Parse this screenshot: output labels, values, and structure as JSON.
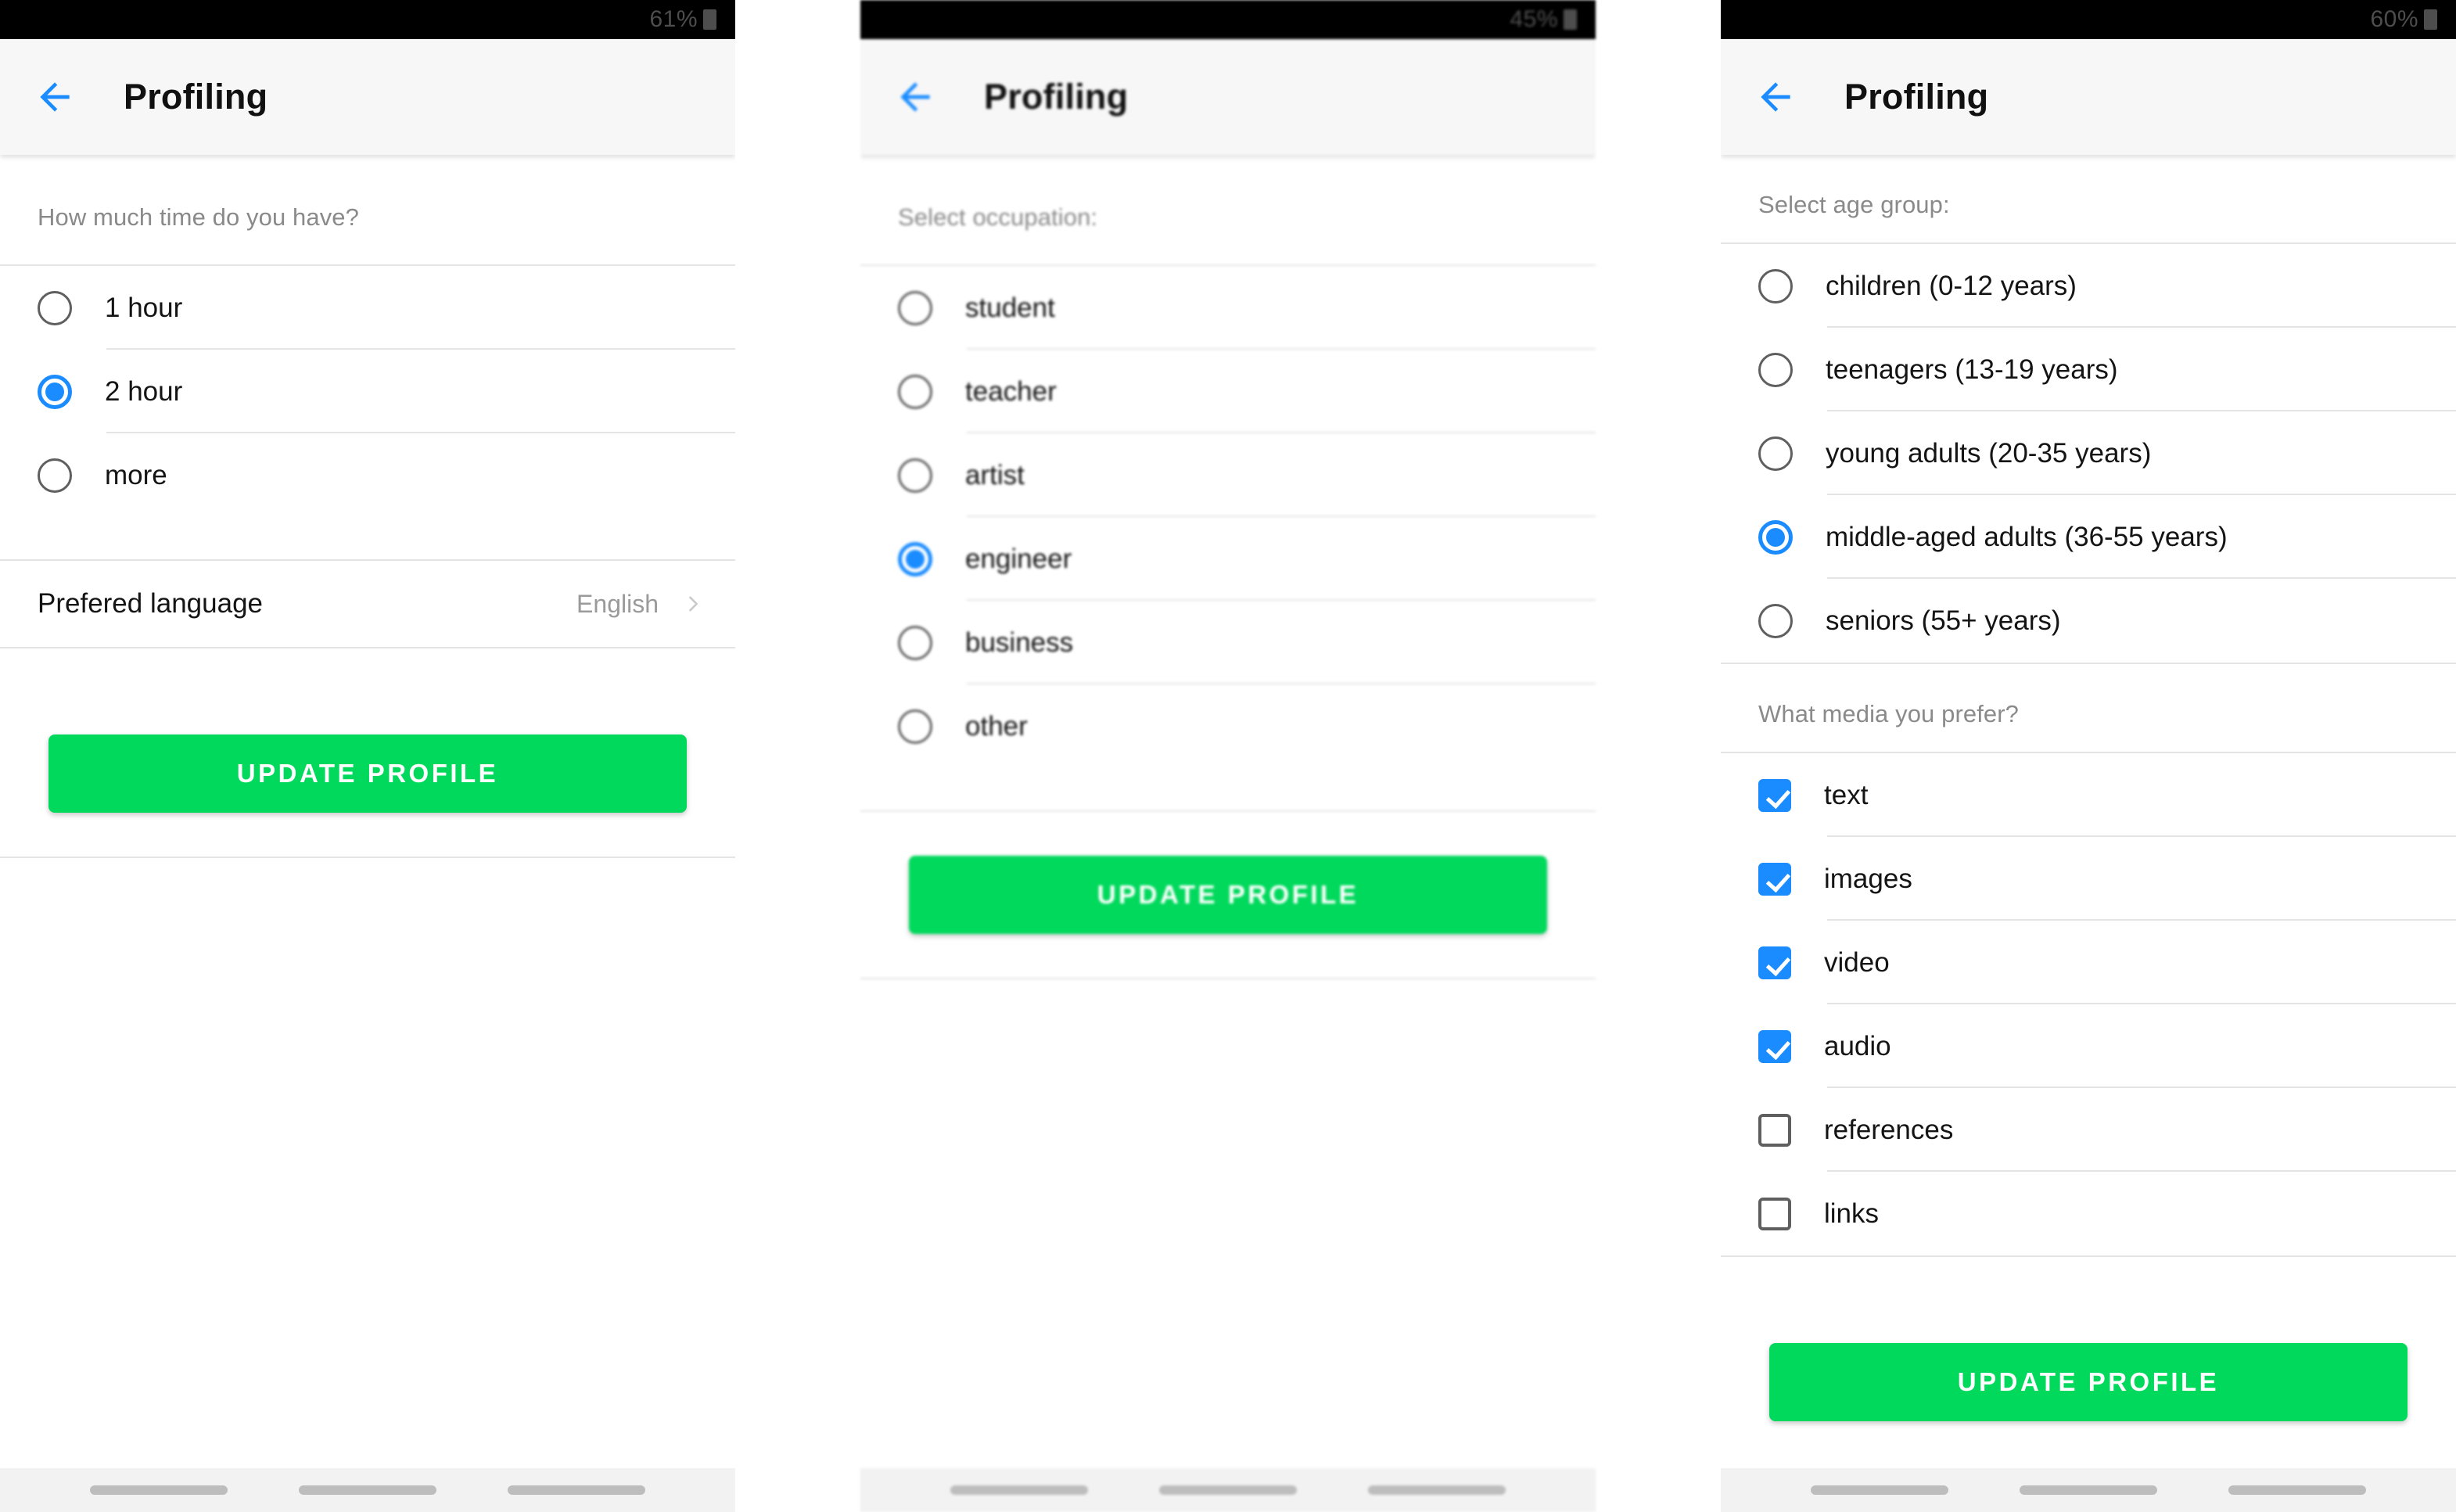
{
  "app": {
    "title": "Profiling",
    "accent_blue": "#1a8cff",
    "accent_green": "#00d95c",
    "back_icon": "arrow-left-icon"
  },
  "screens": [
    {
      "id": "time-and-language",
      "status": {
        "battery": "61%",
        "battery_icon": "battery-icon"
      },
      "title": "Profiling",
      "question": "How much time do you have?",
      "radio_options": [
        {
          "label": "1 hour",
          "selected": false
        },
        {
          "label": "2 hour",
          "selected": true
        },
        {
          "label": "more",
          "selected": false
        }
      ],
      "language_row": {
        "label": "Prefered language",
        "value": "English",
        "chevron_icon": "chevron-right-icon"
      },
      "submit_label": "UPDATE PROFILE"
    },
    {
      "id": "occupation",
      "status": {
        "battery": "45%",
        "battery_icon": "battery-icon"
      },
      "title": "Profiling",
      "question": "Select occupation:",
      "radio_options": [
        {
          "label": "student",
          "selected": false
        },
        {
          "label": "teacher",
          "selected": false
        },
        {
          "label": "artist",
          "selected": false
        },
        {
          "label": "engineer",
          "selected": true
        },
        {
          "label": "business",
          "selected": false
        },
        {
          "label": "other",
          "selected": false
        }
      ],
      "submit_label": "UPDATE PROFILE"
    },
    {
      "id": "age-and-media",
      "status": {
        "battery": "60%",
        "battery_icon": "battery-icon"
      },
      "title": "Profiling",
      "question": "Select age group:",
      "radio_options": [
        {
          "label": "children (0-12 years)",
          "selected": false
        },
        {
          "label": "teenagers (13-19 years)",
          "selected": false
        },
        {
          "label": "young adults (20-35 years)",
          "selected": false
        },
        {
          "label": "middle-aged adults (36-55 years)",
          "selected": true
        },
        {
          "label": "seniors (55+ years)",
          "selected": false
        }
      ],
      "question2": "What media you prefer?",
      "checkbox_options": [
        {
          "label": "text",
          "checked": true
        },
        {
          "label": "images",
          "checked": true
        },
        {
          "label": "video",
          "checked": true
        },
        {
          "label": "audio",
          "checked": true
        },
        {
          "label": "references",
          "checked": false
        },
        {
          "label": "links",
          "checked": false
        }
      ],
      "submit_label": "UPDATE PROFILE"
    }
  ],
  "navbar": {
    "pills": 3
  }
}
